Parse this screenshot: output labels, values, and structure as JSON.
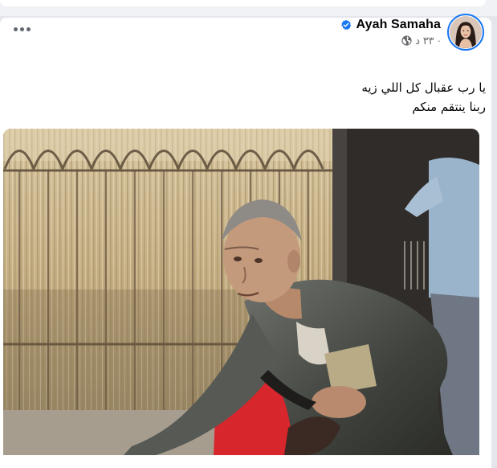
{
  "post": {
    "author_name": "Ayah Samaha",
    "verified_icon": "verified-badge-icon",
    "timestamp": "٣٣ د",
    "separator": "·",
    "audience_icon": "globe-icon",
    "more_icon": "more-horizontal-icon",
    "text_lines": [
      "يا رب عقبال كل اللي زيه",
      "ربنا ينتقم منكم"
    ],
    "photo_icon": "post-photo"
  },
  "colors": {
    "accent": "#1877f2",
    "text_primary": "#050505",
    "text_secondary": "#65676b"
  }
}
